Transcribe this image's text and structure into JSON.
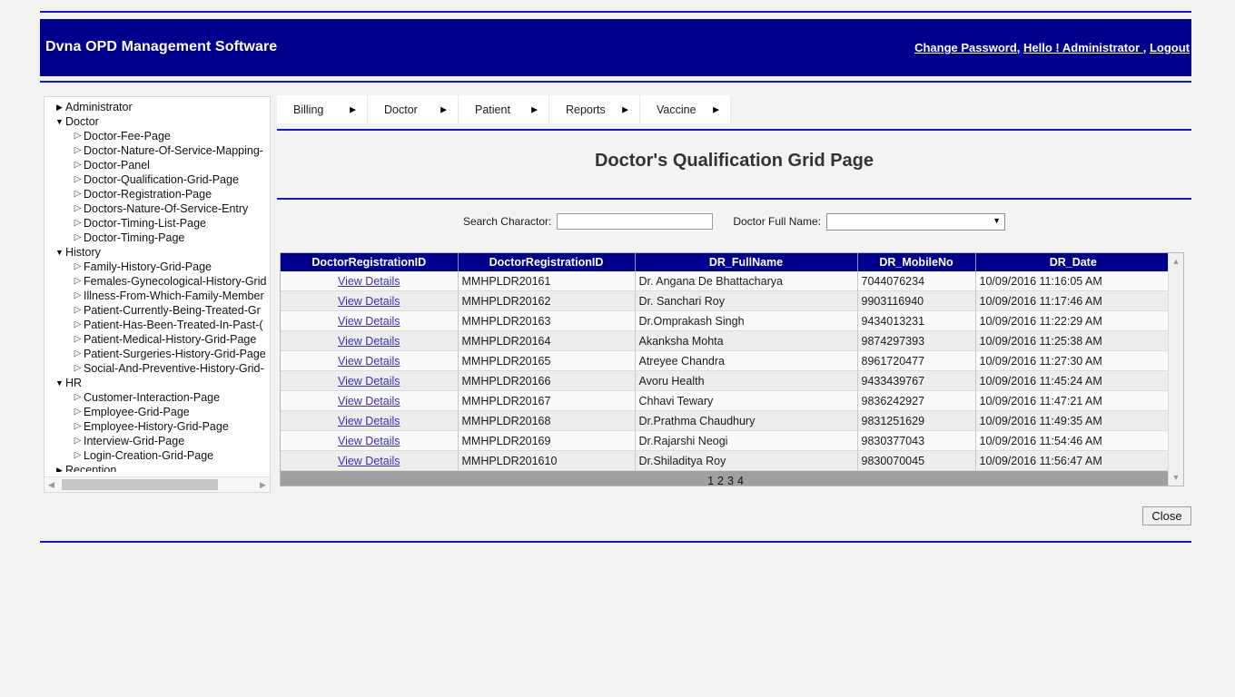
{
  "header": {
    "app_title": "Dvna OPD Management Software",
    "links": [
      {
        "label": "Change Password"
      },
      {
        "label": "Hello ! Administrator "
      },
      {
        "label": "Logout"
      }
    ],
    "separator": ", "
  },
  "sidebar": {
    "items": [
      {
        "label": "Administrator",
        "level": 0,
        "arrow": "collapsed-triangle-icon"
      },
      {
        "label": "Doctor",
        "level": 0,
        "arrow": "expanded-triangle-icon"
      },
      {
        "label": "Doctor-Fee-Page",
        "level": 1,
        "arrow": "leaf-triangle-icon"
      },
      {
        "label": "Doctor-Nature-Of-Service-Mapping-",
        "level": 1,
        "arrow": "leaf-triangle-icon"
      },
      {
        "label": "Doctor-Panel",
        "level": 1,
        "arrow": "leaf-triangle-icon"
      },
      {
        "label": "Doctor-Qualification-Grid-Page",
        "level": 1,
        "arrow": "leaf-triangle-icon"
      },
      {
        "label": "Doctor-Registration-Page",
        "level": 1,
        "arrow": "leaf-triangle-icon"
      },
      {
        "label": "Doctors-Nature-Of-Service-Entry",
        "level": 1,
        "arrow": "leaf-triangle-icon"
      },
      {
        "label": "Doctor-Timing-List-Page",
        "level": 1,
        "arrow": "leaf-triangle-icon"
      },
      {
        "label": "Doctor-Timing-Page",
        "level": 1,
        "arrow": "leaf-triangle-icon"
      },
      {
        "label": "History",
        "level": 0,
        "arrow": "expanded-triangle-icon"
      },
      {
        "label": "Family-History-Grid-Page",
        "level": 1,
        "arrow": "leaf-triangle-icon"
      },
      {
        "label": "Females-Gynecological-History-Grid",
        "level": 1,
        "arrow": "leaf-triangle-icon"
      },
      {
        "label": "Illness-From-Which-Family-Member",
        "level": 1,
        "arrow": "leaf-triangle-icon"
      },
      {
        "label": "Patient-Currently-Being-Treated-Gr",
        "level": 1,
        "arrow": "leaf-triangle-icon"
      },
      {
        "label": "Patient-Has-Been-Treated-In-Past-(",
        "level": 1,
        "arrow": "leaf-triangle-icon"
      },
      {
        "label": "Patient-Medical-History-Grid-Page",
        "level": 1,
        "arrow": "leaf-triangle-icon"
      },
      {
        "label": "Patient-Surgeries-History-Grid-Page",
        "level": 1,
        "arrow": "leaf-triangle-icon"
      },
      {
        "label": "Social-And-Preventive-History-Grid-",
        "level": 1,
        "arrow": "leaf-triangle-icon"
      },
      {
        "label": "HR",
        "level": 0,
        "arrow": "expanded-triangle-icon"
      },
      {
        "label": "Customer-Interaction-Page",
        "level": 1,
        "arrow": "leaf-triangle-icon"
      },
      {
        "label": "Employee-Grid-Page",
        "level": 1,
        "arrow": "leaf-triangle-icon"
      },
      {
        "label": "Employee-History-Grid-Page",
        "level": 1,
        "arrow": "leaf-triangle-icon"
      },
      {
        "label": "Interview-Grid-Page",
        "level": 1,
        "arrow": "leaf-triangle-icon"
      },
      {
        "label": "Login-Creation-Grid-Page",
        "level": 1,
        "arrow": "leaf-triangle-icon"
      },
      {
        "label": "Reception",
        "level": 0,
        "arrow": "collapsed-triangle-icon"
      }
    ]
  },
  "menu": {
    "items": [
      {
        "label": "Billing"
      },
      {
        "label": "Doctor"
      },
      {
        "label": "Patient"
      },
      {
        "label": "Reports"
      },
      {
        "label": "Vaccine"
      }
    ]
  },
  "main": {
    "title": "Doctor's Qualification Grid Page",
    "search": {
      "search_label": "Search Charactor:",
      "search_value": "",
      "search_placeholder": "",
      "doctor_label": "Doctor Full Name:",
      "doctor_selected": "",
      "doctor_options": [
        ""
      ]
    },
    "grid": {
      "columns": [
        "DoctorRegistrationID",
        "DoctorRegistrationID",
        "DR_FullName",
        "DR_MobileNo",
        "DR_Date"
      ],
      "rows": [
        {
          "link": "View Details",
          "reg_id": "MMHPLDR20161",
          "full_name": "Dr. Angana De Bhattacharya",
          "mobile": "7044076234",
          "date": "10/09/2016 11:16:05 AM"
        },
        {
          "link": "View Details",
          "reg_id": "MMHPLDR20162",
          "full_name": "Dr. Sanchari Roy",
          "mobile": "9903116940",
          "date": "10/09/2016 11:17:46 AM"
        },
        {
          "link": "View Details",
          "reg_id": "MMHPLDR20163",
          "full_name": "Dr.Omprakash Singh",
          "mobile": "9434013231",
          "date": "10/09/2016 11:22:29 AM"
        },
        {
          "link": "View Details",
          "reg_id": "MMHPLDR20164",
          "full_name": "Akanksha Mohta",
          "mobile": "9874297393",
          "date": "10/09/2016 11:25:38 AM"
        },
        {
          "link": "View Details",
          "reg_id": "MMHPLDR20165",
          "full_name": "Atreyee Chandra",
          "mobile": "8961720477",
          "date": "10/09/2016 11:27:30 AM"
        },
        {
          "link": "View Details",
          "reg_id": "MMHPLDR20166",
          "full_name": "Avoru Health",
          "mobile": "9433439767",
          "date": "10/09/2016 11:45:24 AM"
        },
        {
          "link": "View Details",
          "reg_id": "MMHPLDR20167",
          "full_name": "Chhavi Tewary",
          "mobile": "9836242927",
          "date": "10/09/2016 11:47:21 AM"
        },
        {
          "link": "View Details",
          "reg_id": "MMHPLDR20168",
          "full_name": "Dr.Prathma Chaudhury",
          "mobile": "9831251629",
          "date": "10/09/2016 11:49:35 AM"
        },
        {
          "link": "View Details",
          "reg_id": "MMHPLDR20169",
          "full_name": "Dr.Rajarshi Neogi",
          "mobile": "9830377043",
          "date": "10/09/2016 11:54:46 AM"
        },
        {
          "link": "View Details",
          "reg_id": "MMHPLDR201610",
          "full_name": "Dr.Shiladitya Roy",
          "mobile": "9830070045",
          "date": "10/09/2016 11:56:47 AM"
        }
      ],
      "pagination": {
        "current": "1",
        "pages": [
          "2",
          "3",
          "4"
        ]
      }
    }
  },
  "footer": {
    "close_label": "Close"
  },
  "colors": {
    "brand_blue": "#00008f",
    "rule_blue": "#1915d6",
    "link_purple": "#3a2db8",
    "pager_gray": "#a0a0a0",
    "page_bg": "#f2f2f2"
  }
}
